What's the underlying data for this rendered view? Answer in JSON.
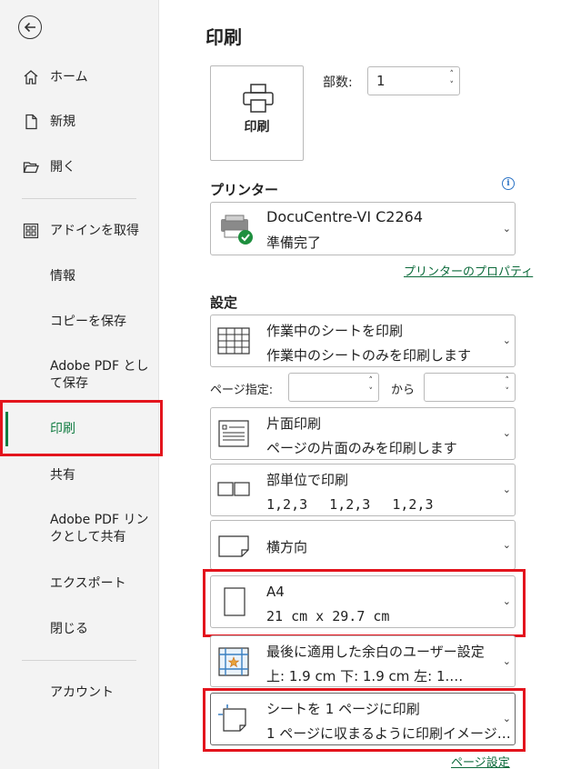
{
  "sidebar": {
    "items": [
      {
        "label": "ホーム",
        "icon": "home-icon"
      },
      {
        "label": "新規",
        "icon": "new-document-icon"
      },
      {
        "label": "開く",
        "icon": "folder-open-icon"
      },
      {
        "label": "アドインを取得",
        "icon": "addins-grid-icon"
      },
      {
        "label": "情報"
      },
      {
        "label": "コピーを保存"
      },
      {
        "label": "Adobe PDF として保存"
      },
      {
        "label": "印刷"
      },
      {
        "label": "共有"
      },
      {
        "label": "Adobe PDF リンクとして共有"
      },
      {
        "label": "エクスポート"
      },
      {
        "label": "閉じる"
      },
      {
        "label": "アカウント"
      }
    ],
    "active": "印刷",
    "accent_color": "#107c41",
    "highlight_color": "#e3141d"
  },
  "main": {
    "title": "印刷",
    "print_button": "印刷",
    "copies_label": "部数:",
    "copies_value": "1",
    "printer_section": "プリンター",
    "printer": {
      "name": "DocuCentre-VI C2264",
      "status": "準備完了"
    },
    "printer_properties_link": "プリンターのプロパティ",
    "settings_section": "設定",
    "settings": {
      "what": {
        "title": "作業中のシートを印刷",
        "desc": "作業中のシートのみを印刷します"
      },
      "pages_label": "ページ指定:",
      "pages_from": "",
      "pages_to_label": "から",
      "pages_to": "",
      "sides": {
        "title": "片面印刷",
        "desc": "ページの片面のみを印刷します"
      },
      "collate": {
        "title": "部単位で印刷",
        "desc": "1,2,3　  1,2,3　  1,2,3"
      },
      "orientation": {
        "title": "横方向"
      },
      "paper": {
        "title": "A4",
        "desc": "21 cm x 29.7 cm"
      },
      "margins": {
        "title": "最後に適用した余白のユーザー設定",
        "desc": "上: 1.9 cm 下: 1.9 cm 左: 1.…"
      },
      "scaling": {
        "title": "シートを 1 ページに印刷",
        "desc": "1 ページに収まるように印刷イメージ…"
      }
    },
    "page_setup_link": "ページ設定"
  }
}
